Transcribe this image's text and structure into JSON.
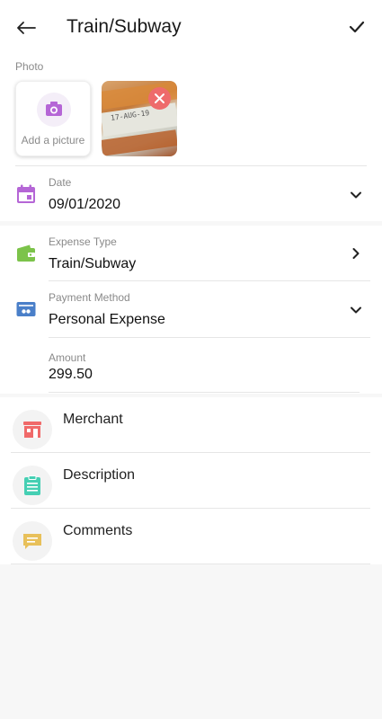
{
  "header": {
    "title": "Train/Subway"
  },
  "photo": {
    "label": "Photo",
    "add_label": "Add a picture",
    "receipt_text": "17-AUG-19"
  },
  "date": {
    "label": "Date",
    "value": "09/01/2020"
  },
  "expense_type": {
    "label": "Expense Type",
    "value": "Train/Subway"
  },
  "payment_method": {
    "label": "Payment Method",
    "value": "Personal Expense"
  },
  "amount": {
    "label": "Amount",
    "value": "299.50"
  },
  "extras": {
    "merchant": "Merchant",
    "description": "Description",
    "comments": "Comments"
  },
  "colors": {
    "accent_purple": "#b566d6",
    "wallet_green": "#7cc34a",
    "card_blue": "#4a7fc9",
    "merchant_red": "#f06a6a",
    "description_teal": "#45cfb3",
    "comments_yellow": "#e8c05a",
    "remove_red": "#ee6b6b"
  },
  "icons": [
    "back-arrow-icon",
    "check-icon",
    "camera-icon",
    "close-icon",
    "calendar-icon",
    "chevron-down-icon",
    "wallet-icon",
    "chevron-right-icon",
    "credit-card-icon",
    "store-icon",
    "clipboard-icon",
    "comment-icon"
  ]
}
